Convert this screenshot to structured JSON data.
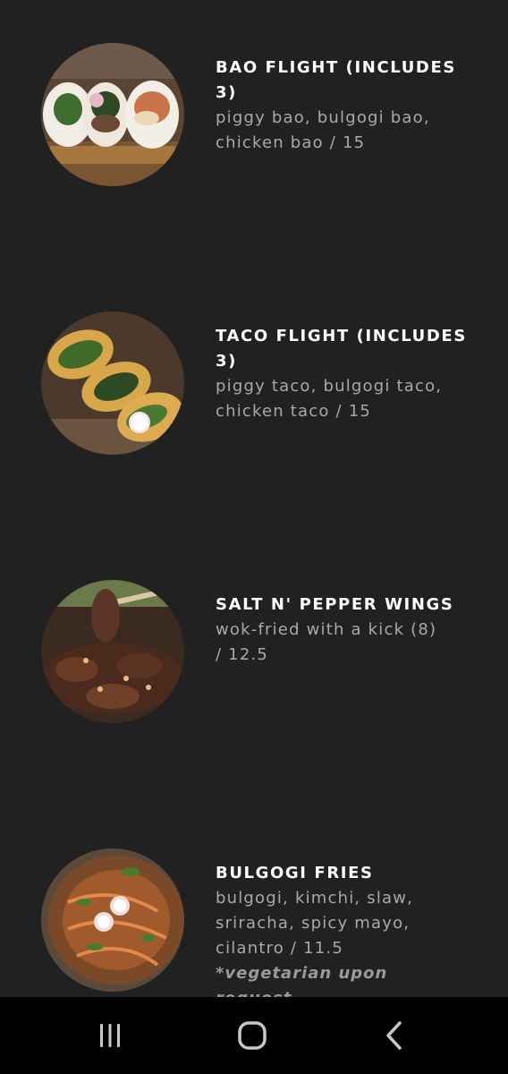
{
  "menu": {
    "items": [
      {
        "title_line1": "BAO FLIGHT (INCLUDES",
        "title_line2": "3)",
        "desc_line1": "piggy bao, bulgogi bao,",
        "desc_line2": "chicken bao / 15",
        "image": "bao-flight-photo"
      },
      {
        "title_line1": "TACO FLIGHT (INCLUDES",
        "title_line2": "3)",
        "desc_line1": "piggy taco, bulgogi taco,",
        "desc_line2": "chicken taco / 15",
        "image": "taco-flight-photo"
      },
      {
        "title_line1": "SALT N' PEPPER WINGS",
        "desc_line1": "wok-fried with a kick (8)",
        "desc_line2": "/ 12.5",
        "image": "salt-pepper-wings-photo"
      },
      {
        "title_line1": "BULGOGI FRIES",
        "desc_line1": "bulgogi, kimchi, slaw,",
        "desc_line2": "sriracha, spicy mayo,",
        "desc_line3": "cilantro / 11.5",
        "note_line1": "*vegetarian upon",
        "note_line2": "request",
        "image": "bulgogi-fries-photo"
      }
    ]
  },
  "nav": {
    "recents_icon": "recent-apps-icon",
    "home_icon": "home-icon",
    "back_icon": "back-icon"
  },
  "colors": {
    "background": "#212121",
    "title": "#ffffff",
    "description": "#a9a9a9",
    "nav_bar": "#000000"
  }
}
